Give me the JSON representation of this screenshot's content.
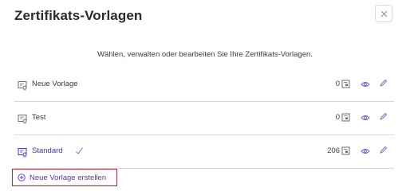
{
  "dialog": {
    "title": "Zertifikats-Vorlagen",
    "subtitle": "Wählen, verwalten oder bearbeiten Sie Ihre Zertifikats-Vorlagen.",
    "close_icon": "close-icon"
  },
  "templates": [
    {
      "name": "Neue Vorlage",
      "count": "0",
      "selected": false
    },
    {
      "name": "Test",
      "count": "0",
      "selected": false
    },
    {
      "name": "Standard",
      "count": "206",
      "selected": true
    }
  ],
  "actions": {
    "create_label": "Neue Vorlage erstellen"
  },
  "colors": {
    "accent": "#5533cc",
    "highlight_border": "#d21f2b",
    "divider": "#d6d6dc",
    "icon": "#6b6b78",
    "eye_icon": "#7a5bd6"
  }
}
